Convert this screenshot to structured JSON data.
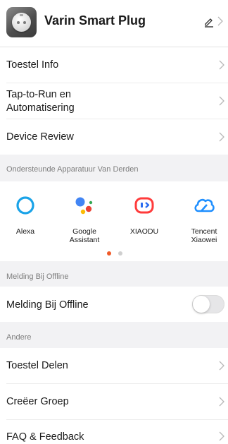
{
  "header": {
    "device_name": "Varin Smart Plug"
  },
  "menu_top": [
    {
      "label": "Toestel Info"
    },
    {
      "label": "Tap-to-Run en Automatisering"
    },
    {
      "label": "Device Review"
    }
  ],
  "third_party": {
    "section_title": "Ondersteunde Apparatuur Van Derden",
    "items": [
      {
        "label": "Alexa",
        "icon": "alexa-icon"
      },
      {
        "label": "Google Assistant",
        "icon": "google-assistant-icon"
      },
      {
        "label": "XIAODU",
        "icon": "xiaodu-icon"
      },
      {
        "label": "Tencent Xiaowei",
        "icon": "tencent-xiaowei-icon"
      }
    ],
    "page_dots": {
      "count": 2,
      "active_index": 0,
      "active_color": "#f05a28",
      "inactive_color": "#cfcfcf"
    }
  },
  "offline": {
    "section_title": "Melding Bij Offline",
    "row_label": "Melding Bij Offline",
    "toggle_on": false
  },
  "other": {
    "section_title": "Andere",
    "items": [
      {
        "label": "Toestel Delen"
      },
      {
        "label": "Creëer Groep"
      },
      {
        "label": "FAQ & Feedback"
      }
    ]
  },
  "colors": {
    "section_bg": "#f2f2f4",
    "chevron": "#b8b8b8",
    "alexa": "#1aa3e8",
    "tencent": "#1f8fff",
    "xiaodu": "#ff3b3b"
  }
}
